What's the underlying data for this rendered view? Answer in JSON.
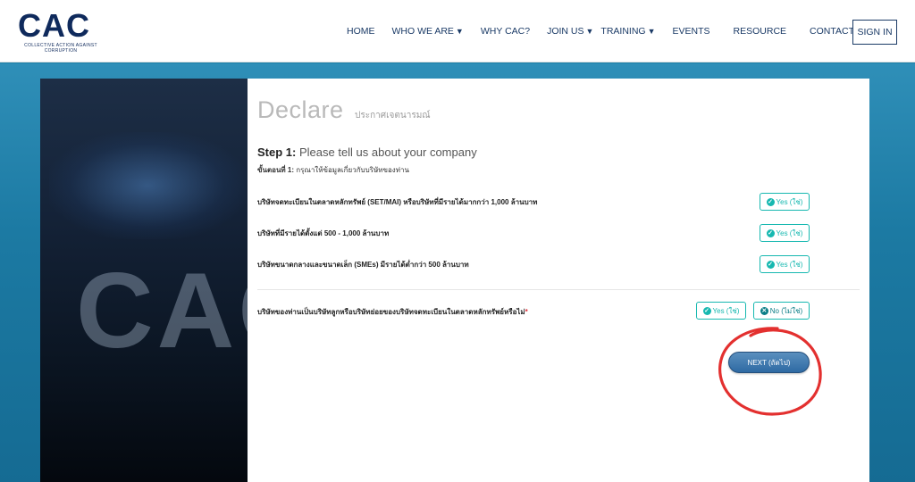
{
  "header": {
    "logo_text": "CAC",
    "logo_subtitle": "COLLECTIVE ACTION AGAINST CORRUPTION",
    "nav": [
      {
        "label": "HOME",
        "has_dropdown": false
      },
      {
        "label": "WHO WE ARE",
        "has_dropdown": true
      },
      {
        "label": "WHY CAC?",
        "has_dropdown": false
      },
      {
        "label": "JOIN US",
        "has_dropdown": true
      },
      {
        "label": "TRAINING",
        "has_dropdown": true
      },
      {
        "label": "EVENTS",
        "has_dropdown": false
      },
      {
        "label": "RESOURCE",
        "has_dropdown": false
      },
      {
        "label": "CONTACT",
        "has_dropdown": false
      }
    ],
    "dropdown_glyph": "▼",
    "signin_label": "SIGN IN"
  },
  "hero": {
    "text": "CAC"
  },
  "form": {
    "title": "Declare",
    "title_thai": "ประกาศเจตนารมณ์",
    "step_label": "Step 1:",
    "step_text": "Please tell us about your company",
    "step_thai_label": "ขั้นตอนที่ 1:",
    "step_thai_text": "กรุณาให้ข้อมูลเกี่ยวกับบริษัทของท่าน",
    "questions": [
      {
        "text": "บริษัทจดทะเบียนในตลาดหลักทรัพย์ (SET/MAI) หรือบริษัทที่มีรายได้มากกว่า 1,000 ล้านบาท",
        "yes_label": "Yes (ใช่)"
      },
      {
        "text": "บริษัทที่มีรายได้ตั้งแต่ 500 - 1,000 ล้านบาท",
        "yes_label": "Yes (ใช่)"
      },
      {
        "text": "บริษัทขนาดกลางและขนาดเล็ก (SMEs) มีรายได้ต่ำกว่า 500 ล้านบาท",
        "yes_label": "Yes (ใช่)"
      }
    ],
    "subsidiary_question": {
      "text": "บริษัทของท่านเป็นบริษัทลูกหรือบริษัทย่อยของบริษัทจดทะเบียนในตลาดหลักทรัพย์หรือไม่",
      "required_mark": "*",
      "yes_label": "Yes (ใช่)",
      "no_label": "No (ไม่ใช่)"
    },
    "next_label": "NEXT (ถัดไป)"
  },
  "colors": {
    "accent": "#16b8b0",
    "brand": "#0f2a5c",
    "annotation": "#e3302f"
  },
  "icons": {
    "yes": "check-circle-icon",
    "no": "x-circle-icon"
  }
}
